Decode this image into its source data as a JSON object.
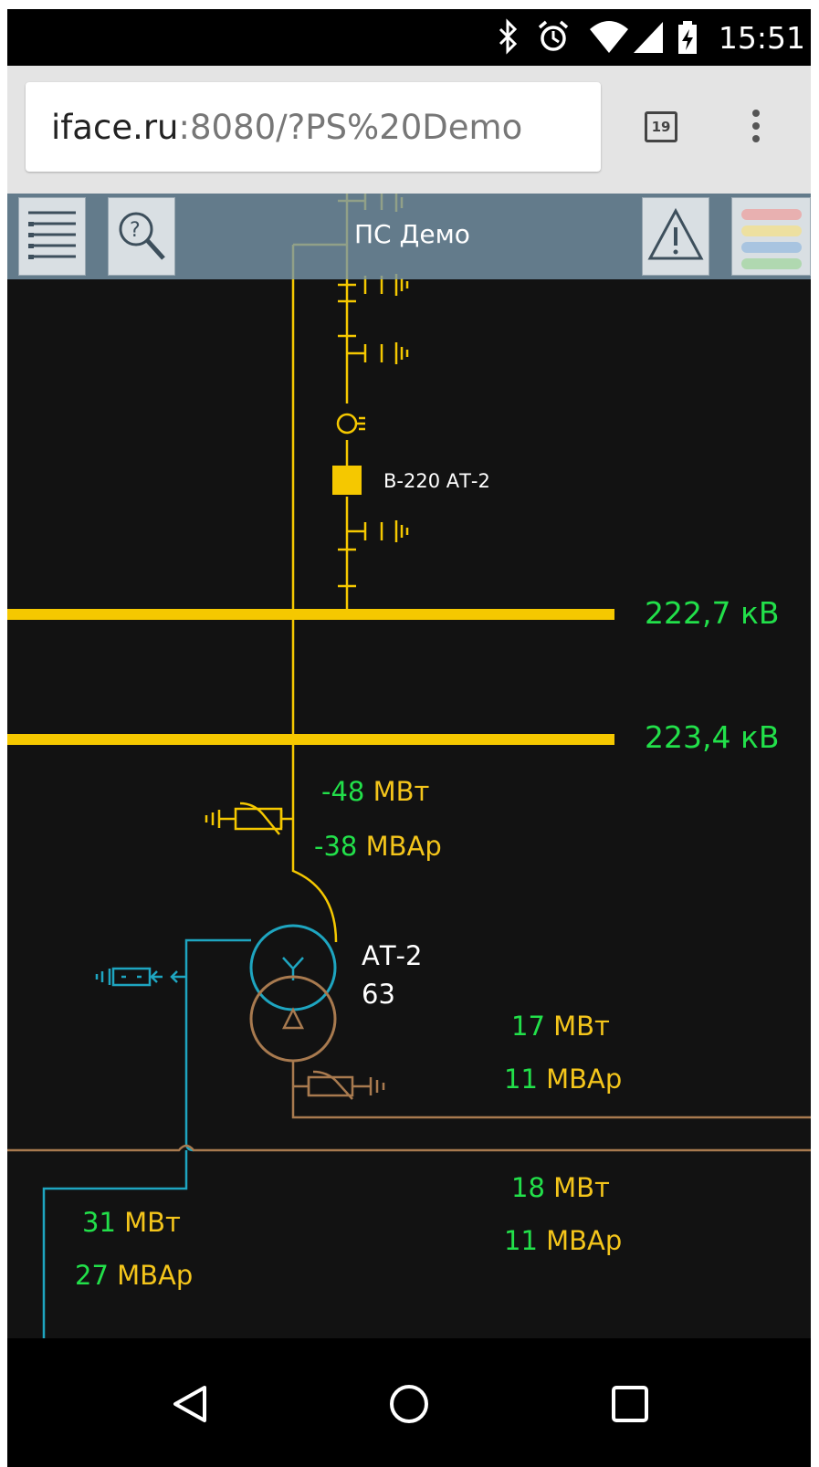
{
  "status_bar": {
    "time": "15:51",
    "icons": [
      "bluetooth-icon",
      "alarm-icon",
      "wifi-icon",
      "signal-icon",
      "battery-charging-icon"
    ]
  },
  "browser": {
    "url_host": "iface.ru",
    "url_rest": ":8080/?PS%20Demo",
    "tab_count": "19"
  },
  "app": {
    "title": "ПС Демо",
    "toolbar": [
      "list-icon",
      "search-help-icon",
      "warning-icon",
      "legend-icon"
    ]
  },
  "scheme": {
    "breaker_label": "В-220 АТ-2",
    "bus1_voltage": "222,7 кВ",
    "bus2_voltage": "223,4 кВ",
    "hv_power_value": "-48",
    "hv_power_unit": "МВт",
    "hv_reactive_value": "-38",
    "hv_reactive_unit": "МВАр",
    "transformer_name": "АТ-2",
    "transformer_rating": "63",
    "lv_power_value": "17",
    "lv_power_unit": "МВт",
    "lv_reactive_value": "11",
    "lv_reactive_unit": "МВАр",
    "feeder_power_value": "18",
    "feeder_power_unit": "МВт",
    "feeder_reactive_value": "11",
    "feeder_reactive_unit": "МВАр",
    "mv_power_value": "31",
    "mv_power_unit": "МВт",
    "mv_reactive_value": "27",
    "mv_reactive_unit": "МВАр"
  },
  "colors": {
    "hv_220": "#f5c800",
    "mv_line": "#1ea5c0",
    "lv_line": "#a87a4f",
    "value_ok": "#22e04a",
    "unit": "#f4c51b"
  },
  "nav": [
    "back-icon",
    "home-icon",
    "recents-icon"
  ]
}
